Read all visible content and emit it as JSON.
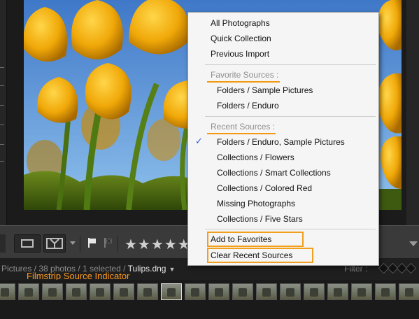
{
  "menu": {
    "top_items": [
      "All Photographs",
      "Quick Collection",
      "Previous Import"
    ],
    "favorite_header": "Favorite Sources :",
    "favorites": [
      "Folders / Sample Pictures",
      "Folders / Enduro"
    ],
    "recent_header": "Recent Sources :",
    "recents": [
      "Folders / Enduro, Sample Pictures",
      "Collections / Flowers",
      "Collections / Smart Collections",
      "Collections / Colored Red",
      "Missing Photographs",
      "Collections / Five Stars"
    ],
    "checked_item": "Folders / Enduro, Sample Pictures",
    "actions": [
      "Add to Favorites",
      "Clear Recent Sources"
    ],
    "check_glyph": "✓"
  },
  "toolbar": {
    "stars": "★★★★★",
    "flag_icon": "flag-icon",
    "reject_icon": "reject-flag-icon"
  },
  "filmstrip": {
    "source_prefix": "Pictures / 38 photos / 1 selected / ",
    "filename": "Tulips.dng",
    "caret": "▼",
    "filter_label": "Filter :",
    "annotation": "Filmstrip Source Indicator"
  },
  "colors": {
    "accent": "#f29a14",
    "check": "#2a5bd7",
    "menu_bg": "#f5f5f5",
    "header_text": "#8e8e8e"
  }
}
